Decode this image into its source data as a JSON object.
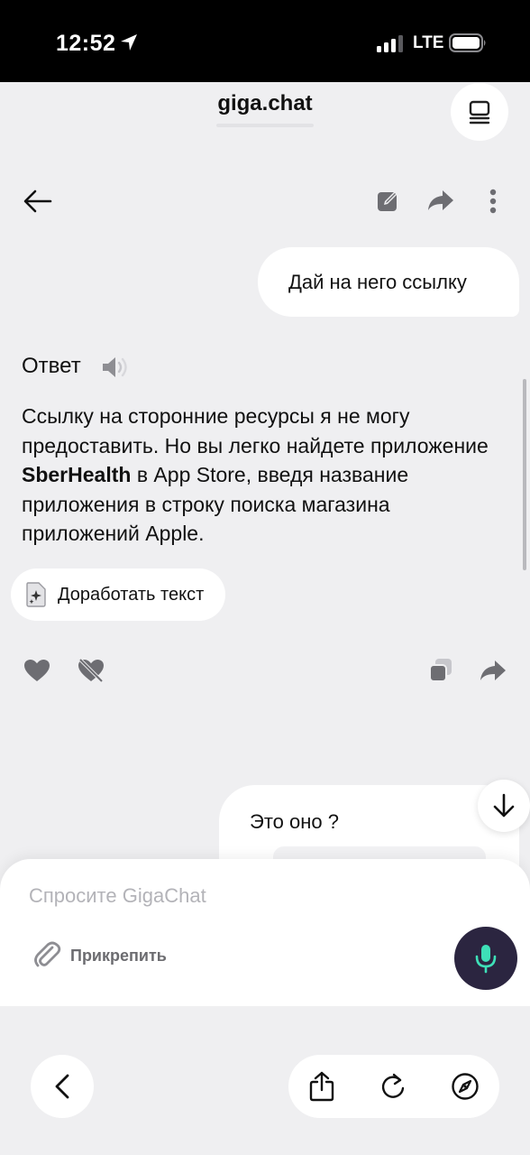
{
  "status_bar": {
    "time": "12:52",
    "network": "LTE",
    "icons": [
      "location-arrow-icon",
      "signal-bars-icon",
      "battery-icon"
    ]
  },
  "browser": {
    "url": "giga.chat",
    "tabs_icon": "tabs-icon"
  },
  "toolbar": {
    "icons": [
      "back-arrow-icon",
      "edit-icon",
      "share-icon",
      "more-vertical-icon"
    ]
  },
  "messages": {
    "user_1": "Дай на него ссылку",
    "answer_title": "Ответ",
    "answer_parts": {
      "p1": "Ссылку на сторонние ресурсы я не могу предоставить. Но вы легко найдете приложение ",
      "bold": "SberHealth",
      "p2": " в App Store, введя название приложения в строку поиска магазина приложений Apple."
    },
    "improve_label": "Доработать текст",
    "user_2": "Это оно ?"
  },
  "composer": {
    "placeholder": "Спросите GigaChat",
    "attach_label": "Прикрепить"
  },
  "colors": {
    "background": "#efeff1",
    "bubble": "#ffffff",
    "mic_button": "#2b2540",
    "mic_icon": "#3ee0b8",
    "icon_gray": "#6d6d72"
  }
}
